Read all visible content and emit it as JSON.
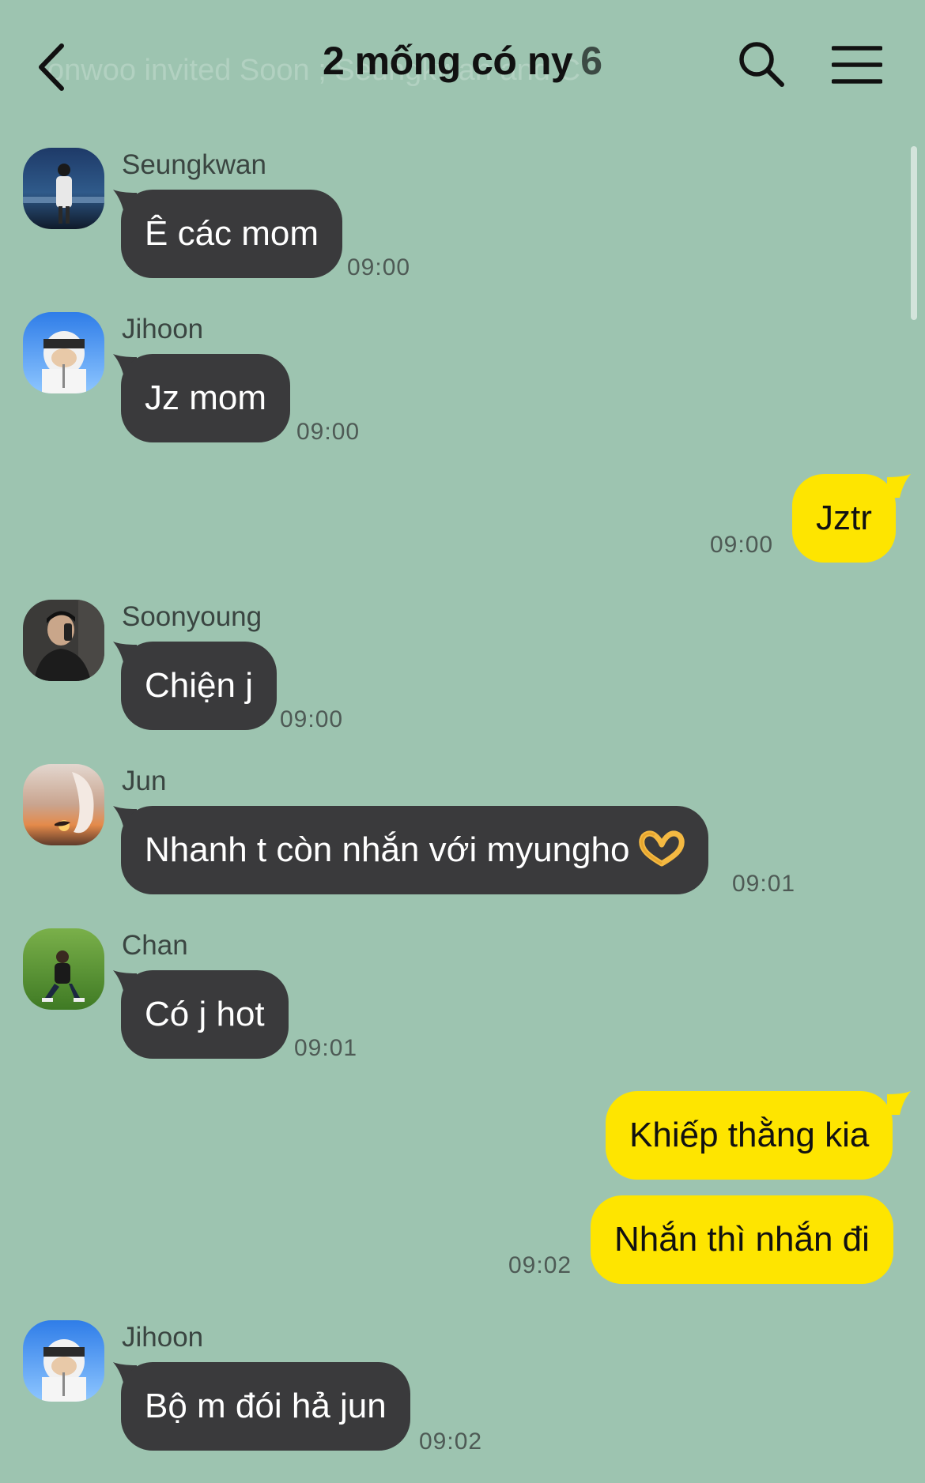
{
  "header": {
    "title": "2 mống có ny",
    "member_count": "6",
    "ticker_text": "onwoo invited Soon                                        ; Seungkwan and C"
  },
  "messages": [
    {
      "sender": "Seungkwan",
      "text": "Ê các mom",
      "time": "09:00",
      "direction": "in"
    },
    {
      "sender": "Jihoon",
      "text": "Jz mom",
      "time": "09:00",
      "direction": "in"
    },
    {
      "sender": "",
      "text": "Jztr",
      "time": "09:00",
      "direction": "out"
    },
    {
      "sender": "Soonyoung",
      "text": "Chiện j",
      "time": "09:00",
      "direction": "in"
    },
    {
      "sender": "Jun",
      "text": "Nhanh t còn nhắn với myungho",
      "emoji": "heart-hands-emoji",
      "time": "09:01",
      "direction": "in"
    },
    {
      "sender": "Chan",
      "text": "Có j hot",
      "time": "09:01",
      "direction": "in"
    },
    {
      "sender": "",
      "text": "Khiếp thằng kia",
      "time": "",
      "direction": "out"
    },
    {
      "sender": "",
      "text": "Nhắn thì nhắn đi",
      "time": "09:02",
      "direction": "out"
    },
    {
      "sender": "Jihoon",
      "text": "Bộ m đói hả jun",
      "time": "09:02",
      "direction": "in"
    }
  ],
  "colors": {
    "background": "#9dc4b0",
    "incoming_bubble": "#3a3a3c",
    "outgoing_bubble": "#fee500"
  },
  "icons": {
    "back": "chevron-left-icon",
    "search": "search-icon",
    "menu": "hamburger-menu-icon"
  }
}
